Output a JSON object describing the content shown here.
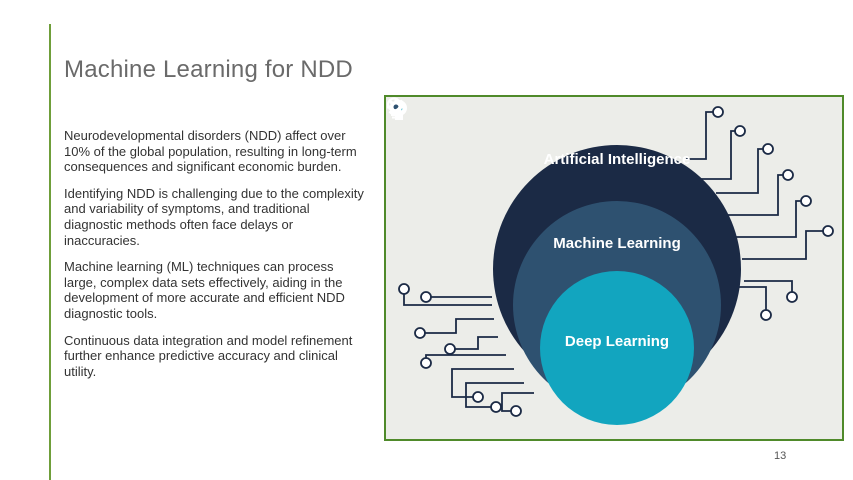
{
  "slide": {
    "title": "Machine Learning for NDD",
    "paragraphs": [
      "Neurodevelopmental disorders (NDD) affect over 10% of the global population, resulting in long-term consequences and significant economic burden.",
      "Identifying NDD is challenging due to the complexity and variability of symptoms, and traditional diagnostic methods often face delays or inaccuracies.",
      "Machine learning (ML) techniques can process large, complex data sets effectively, aiding in the development of more accurate and efficient NDD diagnostic tools.",
      "Continuous data integration and model refinement further enhance predictive accuracy and clinical utility."
    ],
    "page_number": "13"
  },
  "figure": {
    "rings": [
      {
        "label": "Artificial Intelligence",
        "icon": "brain-gear-icon",
        "color": "#1b2a45"
      },
      {
        "label": "Machine Learning",
        "icon": "gear-icon",
        "color": "#2e5170"
      },
      {
        "label": "Deep Learning",
        "icon": "lightbulb-icon",
        "color": "#12a5bf"
      }
    ],
    "border_color": "#4f8a2a",
    "background_color": "#ecede9"
  }
}
